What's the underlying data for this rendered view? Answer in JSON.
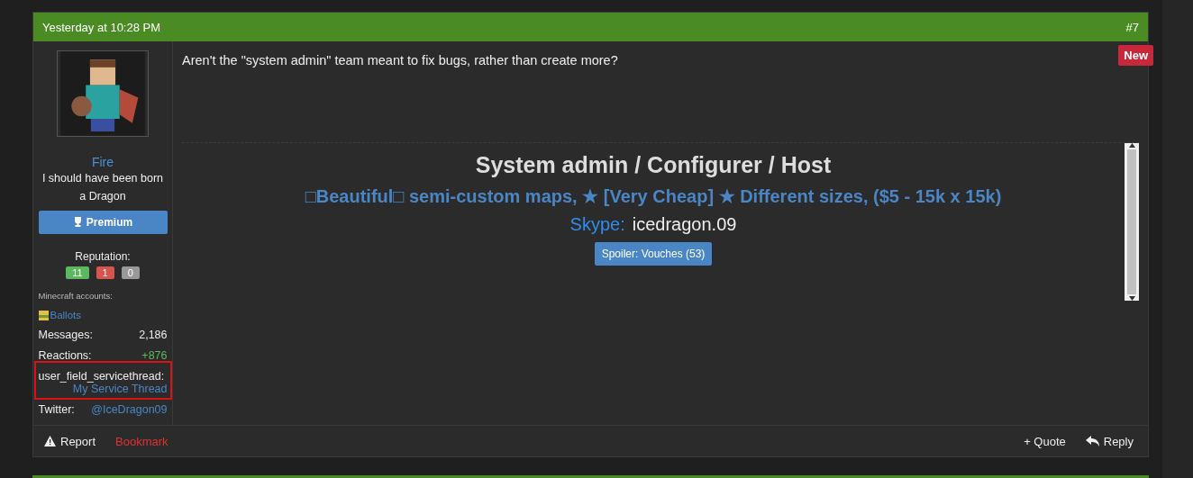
{
  "post": {
    "time": "Yesterday at 10:28 PM",
    "number": "#7",
    "badge": "New",
    "message": "Aren't the \"system admin\" team meant to fix bugs, rather than create more?"
  },
  "user": {
    "name": "Fire",
    "title": "I should have been born a Dragon",
    "rank": "Premium",
    "reputation_label": "Reputation:",
    "reputation": [
      {
        "value": "11",
        "color": "#5cb85c"
      },
      {
        "value": "1",
        "color": "#d9534f"
      },
      {
        "value": "0",
        "color": "#999999"
      }
    ],
    "accounts_label": "Minecraft accounts:",
    "account": "Ballots",
    "stats": [
      {
        "label": "Messages:",
        "value": "2,186",
        "kind": "plain",
        "highlighted": false
      },
      {
        "label": "Reactions:",
        "value": "+876",
        "kind": "positive",
        "highlighted": false
      },
      {
        "label": "user_field_servicethread:",
        "value": "My Service Thread",
        "kind": "link",
        "highlighted": true
      },
      {
        "label": "Twitter:",
        "value": "@IceDragon09",
        "kind": "link",
        "highlighted": false
      }
    ]
  },
  "signature": {
    "heading": "System admin / Configurer / Host",
    "tagline": "□Beautiful□ semi-custom maps, ★ [Very Cheap] ★ Different sizes, ($5 - 15k x 15k)",
    "skype_label": "Skype:",
    "skype": "icedragon.09",
    "spoiler": "Spoiler: Vouches (53)"
  },
  "actions_left": [
    {
      "label": "Report",
      "kind": "report"
    },
    {
      "label": "Bookmark",
      "kind": "bookmark"
    }
  ],
  "actions_right": [
    {
      "label": "+ Quote",
      "kind": "quote"
    },
    {
      "label": "Reply",
      "kind": "reply"
    }
  ]
}
